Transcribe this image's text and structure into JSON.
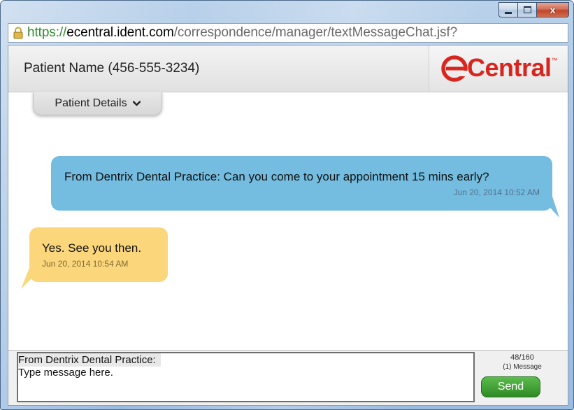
{
  "window": {
    "controls": {
      "minimize": "minimize",
      "maximize": "maximize",
      "close": "x"
    }
  },
  "address": {
    "scheme": "https://",
    "host": "ecentral.ident.com",
    "path": "/correspondence/manager/textMessageChat.jsf?",
    "lock_color": "#2f8a2f"
  },
  "header": {
    "patient_name": "Patient Name (456-555-3234)",
    "logo_text": "Central",
    "logo_tm": "™",
    "brand_color": "#d8261e"
  },
  "details_tab": {
    "label": "Patient Details"
  },
  "messages": [
    {
      "direction": "outgoing",
      "text": "From Dentrix Dental Practice: Can you come to your appointment 15 mins early?",
      "time": "Jun 20, 2014 10:52 AM",
      "color": "#74bde0"
    },
    {
      "direction": "incoming",
      "text": "Yes. See you then.",
      "time": "Jun 20, 2014 10:54 AM",
      "color": "#fbd67a"
    }
  ],
  "compose": {
    "prefix": "From Dentrix Dental Practice:",
    "placeholder": "Type message here.",
    "char_count": "48/160",
    "message_count": "(1) Message",
    "send_label": "Send",
    "send_color": "#2e8b25"
  }
}
